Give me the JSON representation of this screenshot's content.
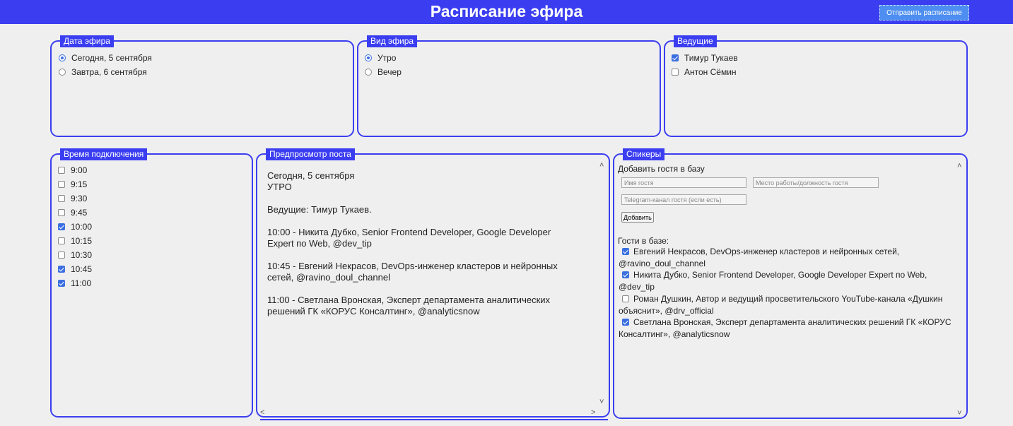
{
  "header": {
    "title": "Расписание эфира",
    "send_button": "Отправить расписание"
  },
  "date_panel": {
    "legend": "Дата эфира",
    "options": [
      {
        "label": "Сегодня, 5 сентября",
        "selected": true
      },
      {
        "label": "Завтра, 6 сентября",
        "selected": false
      }
    ]
  },
  "type_panel": {
    "legend": "Вид эфира",
    "options": [
      {
        "label": "Утро",
        "selected": true
      },
      {
        "label": "Вечер",
        "selected": false
      }
    ]
  },
  "hosts_panel": {
    "legend": "Ведущие",
    "options": [
      {
        "label": "Тимур Тукаев",
        "checked": true
      },
      {
        "label": "Антон Сёмин",
        "checked": false
      }
    ]
  },
  "time_panel": {
    "legend": "Время подключения",
    "slots": [
      {
        "label": "9:00",
        "checked": false
      },
      {
        "label": "9:15",
        "checked": false
      },
      {
        "label": "9:30",
        "checked": false
      },
      {
        "label": "9:45",
        "checked": false
      },
      {
        "label": "10:00",
        "checked": true
      },
      {
        "label": "10:15",
        "checked": false
      },
      {
        "label": "10:30",
        "checked": false
      },
      {
        "label": "10:45",
        "checked": true
      },
      {
        "label": "11:00",
        "checked": true
      }
    ]
  },
  "preview_panel": {
    "legend": "Предпросмотр поста",
    "text": "Сегодня, 5 сентября\nУТРО\n\nВедущие: Тимур Тукаев.\n\n10:00 - Никита Дубко, Senior Frontend Developer, Google Developer Expert по Web, @dev_tip\n\n10:45 - Евгений Некрасов, DevOps-инженер кластеров и нейронных сетей, @ravino_doul_channel\n\n11:00 - Светлана Вронская, Эксперт департамента аналитических решений ГК «КОРУС Консалтинг», @analyticsnow"
  },
  "speakers_panel": {
    "legend": "Спикеры",
    "add_title": "Добавить гостя в базу",
    "name_placeholder": "Имя гостя",
    "job_placeholder": "Место работы/должность гостя",
    "telegram_placeholder": "Telegram-канал гостя (если есть)",
    "add_button": "Добавить",
    "guests_title": "Гости в базе:",
    "guests": [
      {
        "text": "Евгений Некрасов, DevOps-инженер кластеров и нейронных сетей, @ravino_doul_channel",
        "checked": true
      },
      {
        "text": "Никита Дубко, Senior Frontend Developer, Google Developer Expert по Web, @dev_tip",
        "checked": true
      },
      {
        "text": "Роман Душкин, Автор и ведущий просветительского YouTube-канала «Душкин объяснит», @drv_official",
        "checked": false
      },
      {
        "text": "Светлана Вронская, Эксперт департамента аналитических решений ГК «КОРУС Консалтинг», @analyticsnow",
        "checked": true
      }
    ]
  },
  "colors": {
    "accent": "#3b3ef0",
    "button": "#4d8ef0",
    "background": "#efefef"
  }
}
